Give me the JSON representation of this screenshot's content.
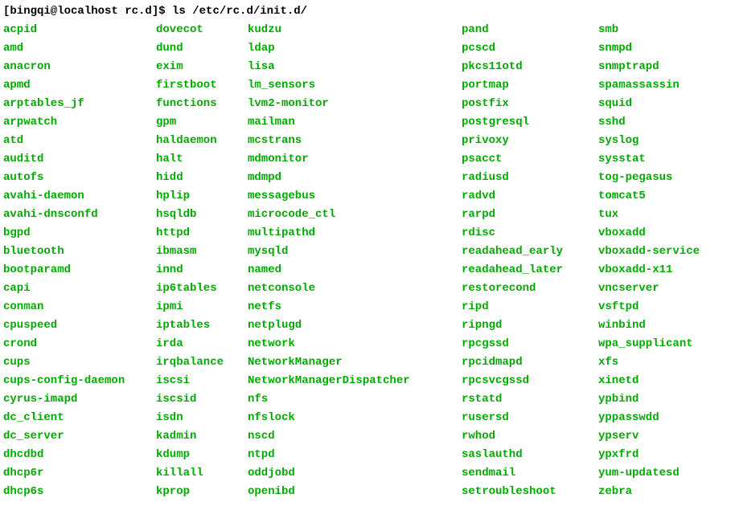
{
  "prompt": "[bingqi@localhost rc.d]$ ls /etc/rc.d/init.d/",
  "columns": [
    [
      "acpid",
      "amd",
      "anacron",
      "apmd",
      "arptables_jf",
      "arpwatch",
      "atd",
      "auditd",
      "autofs",
      "avahi-daemon",
      "avahi-dnsconfd",
      "bgpd",
      "bluetooth",
      "bootparamd",
      "capi",
      "conman",
      "cpuspeed",
      "crond",
      "cups",
      "cups-config-daemon",
      "cyrus-imapd",
      "dc_client",
      "dc_server",
      "dhcdbd",
      "dhcp6r",
      "dhcp6s"
    ],
    [
      "dovecot",
      "dund",
      "exim",
      "firstboot",
      "functions",
      "gpm",
      "haldaemon",
      "halt",
      "hidd",
      "hplip",
      "hsqldb",
      "httpd",
      "ibmasm",
      "innd",
      "ip6tables",
      "ipmi",
      "iptables",
      "irda",
      "irqbalance",
      "iscsi",
      "iscsid",
      "isdn",
      "kadmin",
      "kdump",
      "killall",
      "kprop"
    ],
    [
      "kudzu",
      "ldap",
      "lisa",
      "lm_sensors",
      "lvm2-monitor",
      "mailman",
      "mcstrans",
      "mdmonitor",
      "mdmpd",
      "messagebus",
      "microcode_ctl",
      "multipathd",
      "mysqld",
      "named",
      "netconsole",
      "netfs",
      "netplugd",
      "network",
      "NetworkManager",
      "NetworkManagerDispatcher",
      "nfs",
      "nfslock",
      "nscd",
      "ntpd",
      "oddjobd",
      "openibd"
    ],
    [
      "pand",
      "pcscd",
      "pkcs11otd",
      "portmap",
      "postfix",
      "postgresql",
      "privoxy",
      "psacct",
      "radiusd",
      "radvd",
      "rarpd",
      "rdisc",
      "readahead_early",
      "readahead_later",
      "restorecond",
      "ripd",
      "ripngd",
      "rpcgssd",
      "rpcidmapd",
      "rpcsvcgssd",
      "rstatd",
      "rusersd",
      "rwhod",
      "saslauthd",
      "sendmail",
      "setroubleshoot"
    ],
    [
      "smb",
      "snmpd",
      "snmptrapd",
      "spamassassin",
      "squid",
      "sshd",
      "syslog",
      "sysstat",
      "tog-pegasus",
      "tomcat5",
      "tux",
      "vboxadd",
      "vboxadd-service",
      "vboxadd-x11",
      "vncserver",
      "vsftpd",
      "winbind",
      "wpa_supplicant",
      "xfs",
      "xinetd",
      "ypbind",
      "yppasswdd",
      "ypserv",
      "ypxfrd",
      "yum-updatesd",
      "zebra"
    ]
  ]
}
